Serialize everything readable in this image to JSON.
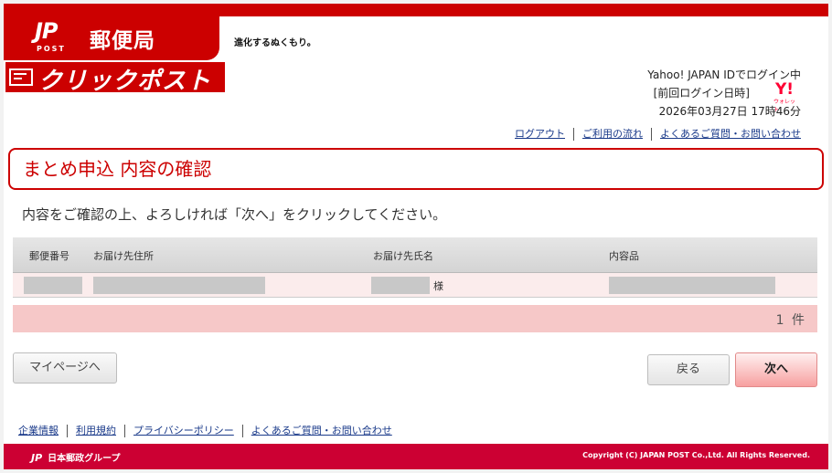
{
  "header": {
    "brand_mark": "JP",
    "brand_post": "POST",
    "post_office_name": "郵便局",
    "tagline": "進化するぬくもり。",
    "service_logo_text": "クリックポスト"
  },
  "login": {
    "status": "Yahoo! JAPAN IDでログイン中",
    "last_login_label": "[前回ログイン日時]",
    "last_login_value": "2026年03月27日 17時46分",
    "wallet_y": "Y!",
    "wallet_text": "ウォレット"
  },
  "top_links": [
    "ログアウト",
    "ご利用の流れ",
    "よくあるご質問・お問い合わせ"
  ],
  "page_title": "まとめ申込 内容の確認",
  "instruction": "内容をご確認の上、よろしければ「次へ」をクリックしてください。",
  "table": {
    "headers": {
      "postal_code": "郵便番号",
      "address": "お届け先住所",
      "name": "お届け先氏名",
      "contents": "内容品"
    },
    "rows": [
      {
        "honorific": "様"
      }
    ],
    "count_label": "1 件"
  },
  "buttons": {
    "mypage": "マイページへ",
    "back": "戻る",
    "next": "次へ"
  },
  "footer": {
    "links": [
      "企業情報",
      "利用規約",
      "プライバシーポリシー",
      "よくあるご質問・お問い合わせ"
    ],
    "group_mark": "JP",
    "group_name": "日本郵政グループ",
    "copyright": "Copyright (C) JAPAN POST Co.,Ltd.  All Rights Reserved."
  }
}
